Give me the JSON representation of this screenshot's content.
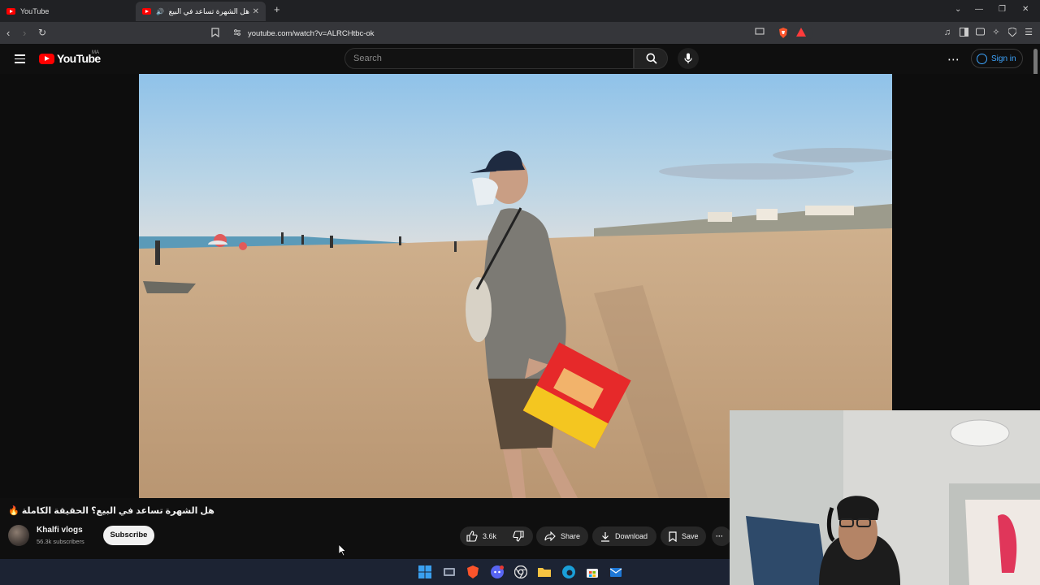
{
  "browser": {
    "tabs": [
      {
        "title": "YouTube",
        "active": false
      },
      {
        "title": "هل الشهرة تساعد في البيع؟ ال",
        "active": true
      }
    ],
    "new_tab_label": "+",
    "url": "youtube.com/watch?v=ALRCHtbc-ok"
  },
  "header": {
    "logo_text": "YouTube",
    "country_code": "MA",
    "search_placeholder": "Search",
    "signin_label": "Sign in"
  },
  "video": {
    "title": "هل الشهرة تساعد في البيع؟ الحقيقة الكاملة 🔥",
    "channel": {
      "name": "Khalfi vlogs",
      "subscribers": "56.3k subscribers"
    },
    "subscribe_label": "Subscribe",
    "actions": {
      "likes": "3.6k",
      "share_label": "Share",
      "download_label": "Download",
      "save_label": "Save",
      "more_label": "···"
    }
  },
  "taskbar": {
    "apps": [
      "windows-start-icon",
      "task-view-icon",
      "brave-icon",
      "discord-icon",
      "chrome-icon",
      "file-explorer-icon",
      "edge-icon",
      "store-icon",
      "mail-icon"
    ]
  },
  "colors": {
    "yt_red": "#ff0000",
    "link_blue": "#3ea6ff",
    "bg": "#0f0f0f"
  }
}
